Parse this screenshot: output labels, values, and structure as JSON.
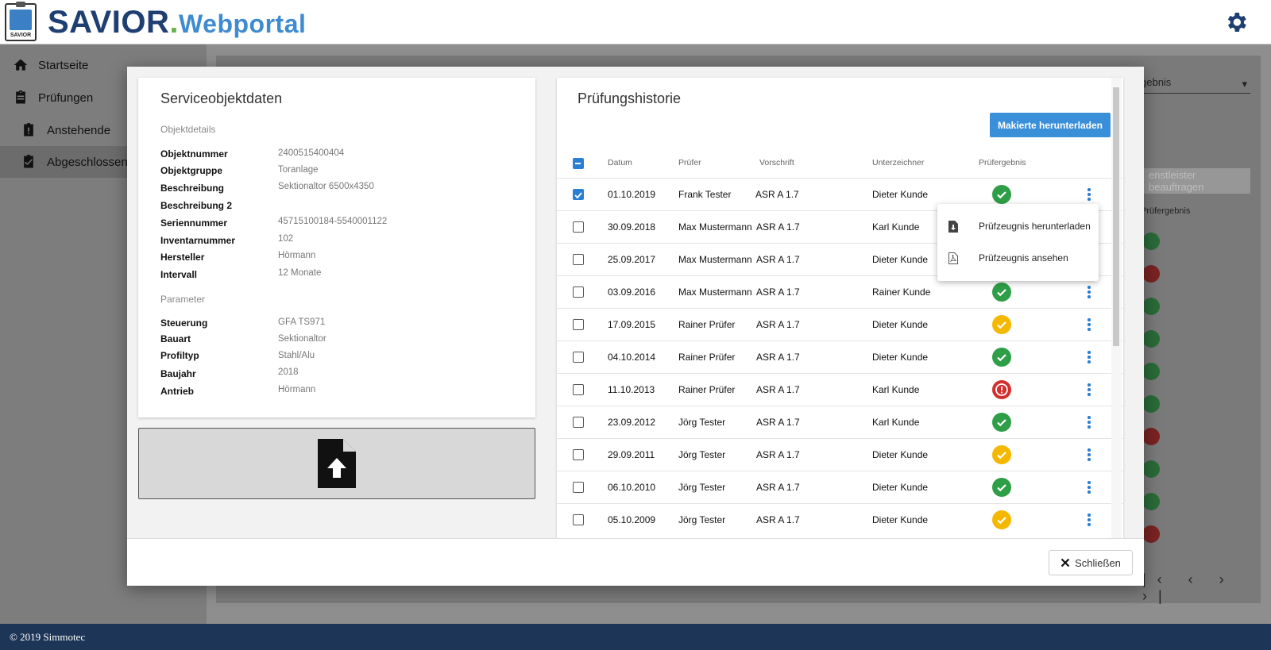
{
  "header": {
    "brand_main": "SAVIOR",
    "brand_dot": ".",
    "brand_sub": "Webportal",
    "logo_text": "SAVIOR"
  },
  "sidebar": {
    "items": [
      {
        "label": "Startseite",
        "icon": "home-icon"
      },
      {
        "label": "Prüfungen",
        "icon": "clipboard-icon"
      },
      {
        "label": "Anstehende",
        "icon": "clipboard-alert-icon"
      },
      {
        "label": "Abgeschlossene",
        "icon": "clipboard-check-icon"
      }
    ]
  },
  "background": {
    "select_label": "gebnis",
    "button_label": "enstleister beauftragen",
    "column_label": "Prüfergebnis",
    "pager": "|‹ ‹ › ›|"
  },
  "left_card": {
    "title": "Serviceobjektdaten",
    "section_details": "Objektdetails",
    "details": [
      {
        "key": "Objektnummer",
        "value": "2400515400404"
      },
      {
        "key": "Objektgruppe",
        "value": "Toranlage"
      },
      {
        "key": "Beschreibung",
        "value": "Sektionaltor 6500x4350"
      },
      {
        "key": "Beschreibung 2",
        "value": ""
      },
      {
        "key": "Seriennummer",
        "value": "45715100184-5540001122"
      },
      {
        "key": "Inventarnummer",
        "value": "102"
      },
      {
        "key": "Hersteller",
        "value": "Hörmann"
      },
      {
        "key": "Intervall",
        "value": "12 Monate"
      }
    ],
    "section_params": "Parameter",
    "params": [
      {
        "key": "Steuerung",
        "value": "GFA TS971"
      },
      {
        "key": "Bauart",
        "value": "Sektionaltor"
      },
      {
        "key": "Profiltyp",
        "value": "Stahl/Alu"
      },
      {
        "key": "Baujahr",
        "value": "2018"
      },
      {
        "key": "Antrieb",
        "value": "Hörmann"
      }
    ]
  },
  "right_card": {
    "title": "Prüfungshistorie",
    "download_button": "Makierte herunterladen",
    "columns": [
      "Datum",
      "Prüfer",
      "Vorschrift",
      "Unterzeichner",
      "Prüfergebnis"
    ],
    "rows": [
      {
        "date": "01.10.2019",
        "inspector": "Frank Tester",
        "rule": "ASR A 1.7",
        "signer": "Dieter Kunde",
        "result": "ok",
        "checked": true
      },
      {
        "date": "30.09.2018",
        "inspector": "Max Mustermann",
        "rule": "ASR A 1.7",
        "signer": "Karl Kunde",
        "result": "ok",
        "checked": false
      },
      {
        "date": "25.09.2017",
        "inspector": "Max Mustermann",
        "rule": "ASR A 1.7",
        "signer": "Dieter Kunde",
        "result": "ok",
        "checked": false
      },
      {
        "date": "03.09.2016",
        "inspector": "Max Mustermann",
        "rule": "ASR A 1.7",
        "signer": "Rainer Kunde",
        "result": "ok",
        "checked": false
      },
      {
        "date": "17.09.2015",
        "inspector": "Rainer Prüfer",
        "rule": "ASR A 1.7",
        "signer": "Dieter Kunde",
        "result": "warn",
        "checked": false
      },
      {
        "date": "04.10.2014",
        "inspector": "Rainer Prüfer",
        "rule": "ASR A 1.7",
        "signer": "Dieter Kunde",
        "result": "ok",
        "checked": false
      },
      {
        "date": "11.10.2013",
        "inspector": "Rainer Prüfer",
        "rule": "ASR A 1.7",
        "signer": "Karl Kunde",
        "result": "err",
        "checked": false
      },
      {
        "date": "23.09.2012",
        "inspector": "Jörg Tester",
        "rule": "ASR A 1.7",
        "signer": "Karl Kunde",
        "result": "ok",
        "checked": false
      },
      {
        "date": "29.09.2011",
        "inspector": "Jörg Tester",
        "rule": "ASR A 1.7",
        "signer": "Dieter Kunde",
        "result": "warn",
        "checked": false
      },
      {
        "date": "06.10.2010",
        "inspector": "Jörg Tester",
        "rule": "ASR A 1.7",
        "signer": "Dieter Kunde",
        "result": "ok",
        "checked": false
      },
      {
        "date": "05.10.2009",
        "inspector": "Jörg Tester",
        "rule": "ASR A 1.7",
        "signer": "Dieter Kunde",
        "result": "warn",
        "checked": false
      }
    ]
  },
  "context_menu": {
    "items": [
      {
        "label": "Prüfzeugnis herunterladen",
        "icon": "file-download-icon"
      },
      {
        "label": "Prüfzeugnis ansehen",
        "icon": "file-pdf-icon"
      }
    ]
  },
  "modal": {
    "close_label": "Schließen"
  },
  "footer": {
    "text": "© 2019 Simmotec"
  },
  "colors": {
    "brand": "#1f3f73",
    "accent": "#3a8fd9",
    "ok": "#2e9e47",
    "warn": "#f5b800",
    "err": "#d32f2f",
    "footer": "#1d3557"
  }
}
